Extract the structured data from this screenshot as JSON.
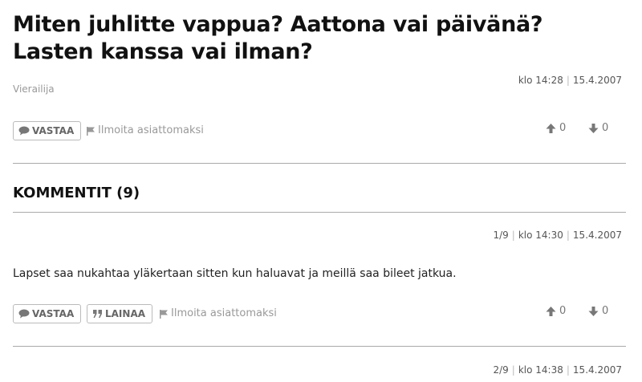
{
  "post": {
    "title": "Miten juhlitte vappua? Aattona vai päivänä? Lasten kanssa vai ilman?",
    "author": "Vierailija",
    "time": "klo 14:28",
    "date": "15.4.2007",
    "reply_label": "VASTAA",
    "report_label": "Ilmoita asiattomaksi",
    "upvotes": "0",
    "downvotes": "0"
  },
  "comments_section": {
    "heading": "KOMMENTIT (9)"
  },
  "comments": [
    {
      "index": "1/9",
      "time": "klo 14:30",
      "date": "15.4.2007",
      "text": "Lapset saa nukahtaa yläkertaan sitten kun haluavat ja meillä saa bileet jatkua.",
      "reply_label": "VASTAA",
      "quote_label": "LAINAA",
      "report_label": "Ilmoita asiattomaksi",
      "upvotes": "0",
      "downvotes": "0"
    },
    {
      "index": "2/9",
      "time": "klo 14:38",
      "date": "15.4.2007"
    }
  ],
  "icons": {
    "reply": "speech-bubble-icon",
    "quote": "quote-marks-icon",
    "report": "flag-icon",
    "upvote": "arrow-up-icon",
    "downvote": "arrow-down-icon"
  },
  "colors": {
    "text": "#111111",
    "muted": "#999999",
    "divider": "#aaaaaa",
    "button_border": "#bbbbbb"
  }
}
